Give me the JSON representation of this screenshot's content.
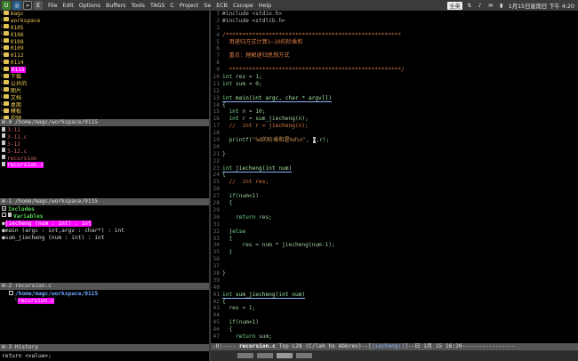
{
  "topbar": {
    "menus": [
      "File",
      "Edit",
      "Options",
      "Buffers",
      "Tools",
      "TAGS",
      "C",
      "Project",
      "Se",
      "ECB",
      "Cscope",
      "Help"
    ],
    "ime_label": "全英",
    "clock": "1月15日星期日 下午 4:20"
  },
  "dir_pane": {
    "lines": [
      {
        "indent": "    ",
        "name": "magc",
        "kind": "dir"
      },
      {
        "indent": "      ",
        "name": "workspace",
        "kind": "dir"
      },
      {
        "indent": "        ",
        "name": "0105",
        "kind": "dir"
      },
      {
        "indent": "        ",
        "name": "0106",
        "kind": "dir"
      },
      {
        "indent": "        ",
        "name": "0108",
        "kind": "dir"
      },
      {
        "indent": "        ",
        "name": "0109",
        "kind": "dir"
      },
      {
        "indent": "        ",
        "name": "0112",
        "kind": "dir"
      },
      {
        "indent": "        ",
        "name": "0114",
        "kind": "dir"
      },
      {
        "indent": "        ",
        "name": "0115",
        "kind": "dir",
        "selected": true
      },
      {
        "indent": "    ",
        "name": "下载",
        "kind": "dir"
      },
      {
        "indent": "    ",
        "name": "公共的",
        "kind": "dir"
      },
      {
        "indent": "    ",
        "name": "图片",
        "kind": "dir"
      },
      {
        "indent": "    ",
        "name": "文档",
        "kind": "dir"
      },
      {
        "indent": "    ",
        "name": "桌面",
        "kind": "dir"
      },
      {
        "indent": "    ",
        "name": "模板",
        "kind": "dir"
      },
      {
        "indent": "    ",
        "name": "视频",
        "kind": "dir"
      }
    ],
    "modeline": "W-0 /home/magc/workspace/0115"
  },
  "files_pane": {
    "lines": [
      {
        "name": "3-11"
      },
      {
        "name": "3-11.c"
      },
      {
        "name": "3-12"
      },
      {
        "name": "3-12.c"
      },
      {
        "name": "recursion"
      },
      {
        "name": "recursion.c",
        "selected": true
      }
    ],
    "modeline": "W-1 /home/magc/workspace/0115"
  },
  "methods_pane": {
    "categories": [
      {
        "label": "Includes",
        "box": "+"
      },
      {
        "label": "Variables",
        "box": "-"
      }
    ],
    "functions": [
      {
        "sig": "jiecheng (num : int) : int",
        "selected": true
      },
      {
        "sig": "main (argc : int,argv : char*) : int"
      },
      {
        "sig": "sum_jiecheng (num : int) : int"
      }
    ],
    "modeline": "W-2 recursion.c"
  },
  "history_pane": {
    "path": "/home/magc/workspace/0115",
    "item": "recursion.c",
    "modeline": "W-3 History"
  },
  "minibuffer": "return <value>;",
  "editor": {
    "lines": [
      {
        "n": "1",
        "t": [
          [
            "pre",
            "#include <stdio.h>"
          ]
        ]
      },
      {
        "n": "2",
        "t": [
          [
            "pre",
            "#include <stdlib.h>"
          ]
        ]
      },
      {
        "n": "3",
        "t": []
      },
      {
        "n": "4",
        "t": [
          [
            "cmt",
            "/*****************************************************"
          ]
        ]
      },
      {
        "n": "5",
        "t": [
          [
            "cmt",
            "  用递归方式计算1~10的阶乘和"
          ]
        ]
      },
      {
        "n": "6",
        "t": []
      },
      {
        "n": "7",
        "t": [
          [
            "cmt",
            "  重点：理解递归思想方式"
          ]
        ]
      },
      {
        "n": "8",
        "t": []
      },
      {
        "n": "9",
        "t": [
          [
            "cmt",
            "  ****************************************************/"
          ]
        ]
      },
      {
        "n": "10",
        "t": [
          [
            "kw",
            "int"
          ],
          [
            "plain",
            " res = 1;"
          ]
        ]
      },
      {
        "n": "11",
        "t": [
          [
            "kw",
            "int"
          ],
          [
            "plain",
            " sum = 0;"
          ]
        ]
      },
      {
        "n": "12",
        "t": []
      },
      {
        "n": "13",
        "t": [
          [
            "kw",
            "int"
          ],
          [
            "fn",
            " main(int argc, char * argv[])"
          ]
        ],
        "fnline": true
      },
      {
        "n": "14",
        "t": [
          [
            "plain",
            "{"
          ]
        ]
      },
      {
        "n": "15",
        "t": [
          [
            "plain",
            "  "
          ],
          [
            "kw",
            "int"
          ],
          [
            "plain",
            " n = 10;"
          ]
        ]
      },
      {
        "n": "16",
        "t": [
          [
            "plain",
            "  "
          ],
          [
            "kw",
            "int"
          ],
          [
            "plain",
            " r = sum_jiecheng(n);"
          ]
        ]
      },
      {
        "n": "17",
        "t": [
          [
            "plain",
            "  "
          ],
          [
            "cmt",
            "//  int r = jiecheng(n);"
          ]
        ]
      },
      {
        "n": "18",
        "t": []
      },
      {
        "n": "19",
        "t": [
          [
            "plain",
            "  printf("
          ],
          [
            "str",
            "\"%d的阶乘和是%d\\n\""
          ],
          [
            "plain",
            ", "
          ],
          [
            "cur",
            "n"
          ],
          [
            "plain",
            ",r);"
          ]
        ]
      },
      {
        "n": "20",
        "t": []
      },
      {
        "n": "21",
        "t": [
          [
            "plain",
            "}"
          ]
        ]
      },
      {
        "n": "22",
        "t": []
      },
      {
        "n": "23",
        "t": [
          [
            "kw",
            "int"
          ],
          [
            "fn",
            " jiecheng(int num)"
          ]
        ],
        "fnline": true
      },
      {
        "n": "24",
        "t": [
          [
            "plain",
            "{"
          ]
        ]
      },
      {
        "n": "25",
        "t": [
          [
            "plain",
            "  "
          ],
          [
            "cmt",
            "//  int res;"
          ]
        ]
      },
      {
        "n": "26",
        "t": []
      },
      {
        "n": "27",
        "t": [
          [
            "plain",
            "  "
          ],
          [
            "kw",
            "if"
          ],
          [
            "plain",
            "(num<1)"
          ]
        ]
      },
      {
        "n": "28",
        "t": [
          [
            "plain",
            "  {"
          ]
        ]
      },
      {
        "n": "29",
        "t": []
      },
      {
        "n": "30",
        "t": [
          [
            "plain",
            "    "
          ],
          [
            "kw",
            "return"
          ],
          [
            "plain",
            " res;"
          ]
        ]
      },
      {
        "n": "31",
        "t": []
      },
      {
        "n": "32",
        "t": [
          [
            "plain",
            "  }"
          ],
          [
            "kw",
            "else"
          ]
        ]
      },
      {
        "n": "33",
        "t": [
          [
            "plain",
            "  {"
          ]
        ]
      },
      {
        "n": "34",
        "t": [
          [
            "plain",
            "      res = num * jiecheng(num-1);"
          ]
        ]
      },
      {
        "n": "35",
        "t": [
          [
            "plain",
            "  }"
          ]
        ]
      },
      {
        "n": "36",
        "t": []
      },
      {
        "n": "37",
        "t": []
      },
      {
        "n": "38",
        "t": [
          [
            "plain",
            "}"
          ]
        ]
      },
      {
        "n": "39",
        "t": []
      },
      {
        "n": "40",
        "t": []
      },
      {
        "n": "41",
        "t": [
          [
            "kw",
            "int"
          ],
          [
            "fn",
            " sum_jiecheng(int num)"
          ]
        ],
        "fnline": true
      },
      {
        "n": "42",
        "t": [
          [
            "plain",
            "{"
          ]
        ]
      },
      {
        "n": "43",
        "t": [
          [
            "plain",
            "  res = 1;"
          ]
        ]
      },
      {
        "n": "44",
        "t": []
      },
      {
        "n": "45",
        "t": [
          [
            "plain",
            "  "
          ],
          [
            "kw",
            "if"
          ],
          [
            "plain",
            "(num<1)"
          ]
        ]
      },
      {
        "n": "46",
        "t": [
          [
            "plain",
            "  {"
          ]
        ]
      },
      {
        "n": "47",
        "t": [
          [
            "plain",
            "    "
          ],
          [
            "kw",
            "return"
          ],
          [
            "plain",
            " sum;"
          ]
        ]
      }
    ],
    "modeline": {
      "prefix": "-U:----  ",
      "buffer": "recursion.c",
      "pos": "    Top L28    (C/lah hs Abbrev)--[",
      "which": "jiecheng()",
      "suffix": "]--日  1月 15 16:20----------------"
    }
  }
}
